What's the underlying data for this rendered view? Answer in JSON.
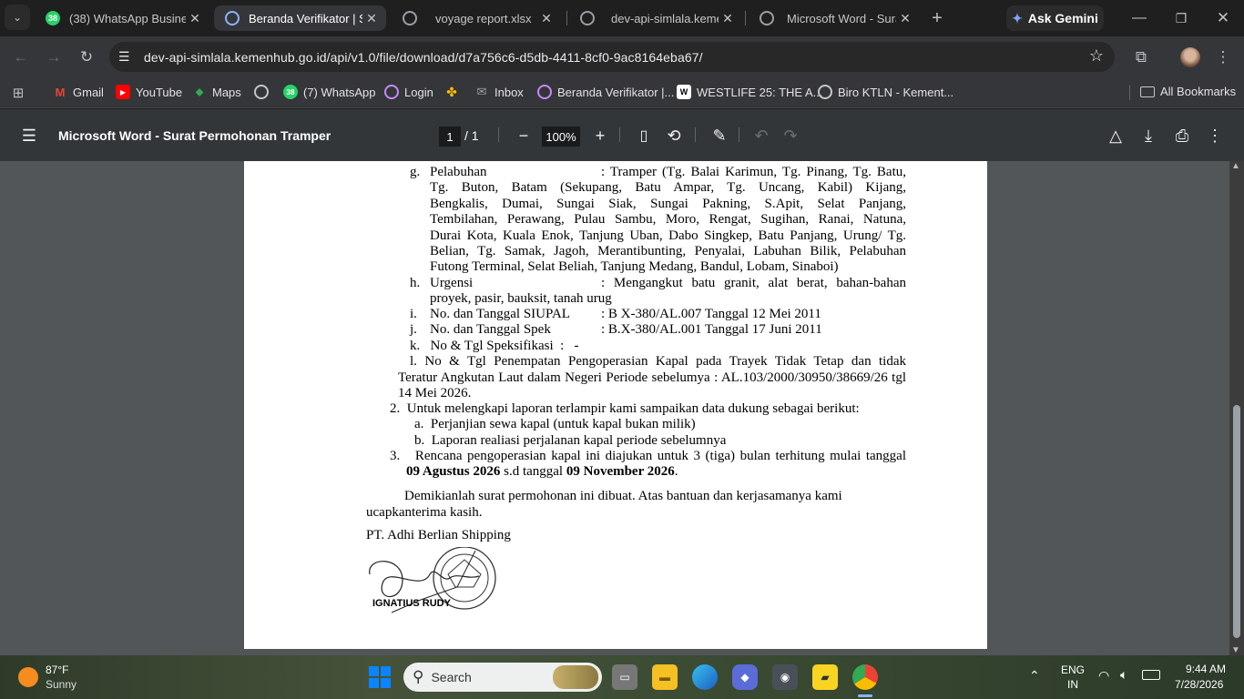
{
  "tabs": [
    {
      "title": "(38) WhatsApp Busines",
      "badge": "38",
      "color": "#25d366"
    },
    {
      "title": "Beranda Verifikator | Si",
      "badge": "",
      "color": "#8ab4f8"
    },
    {
      "title": "voyage report.xlsx",
      "badge": "",
      "color": "#9aa0a6"
    },
    {
      "title": "dev-api-simlala.kemenl",
      "badge": "",
      "color": "#9aa0a6"
    },
    {
      "title": "Microsoft Word - Surat",
      "badge": "",
      "color": "#9aa0a6"
    }
  ],
  "ask_gemini": "Ask Gemini",
  "url": "dev-api-simlala.kemenhub.go.id/api/v1.0/file/download/d7a756c6-d5db-4411-8cf0-9ac8164eba67/",
  "bookmarks": {
    "items": [
      "Gmail",
      "YouTube",
      "Maps",
      "",
      "(7) WhatsApp",
      "Login",
      "",
      "Inbox",
      "Beranda Verifikator |...",
      "WESTLIFE 25: THE A...",
      "Biro KTLN - Kement..."
    ],
    "all": "All Bookmarks"
  },
  "pdf": {
    "title": "Microsoft Word - Surat Permohonan Tramper",
    "page_current": "1",
    "page_total": "/ 1",
    "zoom": "100%"
  },
  "doc": {
    "g_label": "g.",
    "g_key": "Pelabuhan",
    "g_lines": [
      ": Tramper (Tg. Balai Karimun, Tg. Pinang, Tg. Batu,",
      "Tg. Buton, Batam (Sekupang, Batu Ampar, Tg. Uncang, Kabil) Kijang,",
      "Bengkalis, Dumai, Sungai Siak, Sungai Pakning, S.Apit, Selat Panjang,",
      "Tembilahan, Perawang, Pulau Sambu, Moro, Rengat, Sugihan, Ranai, Natuna,",
      "Durai Kota, Kuala Enok, Tanjung Uban, Dabo Singkep, Batu Panjang, Urung/ Tg.",
      "Belian, Tg. Samak, Jagoh, Merantibunting, Penyalai, Labuhan Bilik, Pelabuhan",
      "Futong Terminal, Selat Beliah, Tanjung Medang, Bandul, Lobam, Sinaboi)"
    ],
    "h_label": "h.",
    "h_key": "Urgensi",
    "h_line1": ": Mengangkut batu granit, alat berat, bahan-bahan",
    "h_line2": "proyek, pasir, bauksit, tanah urug",
    "i_label": "i.",
    "i_key": "No. dan Tanggal SIUPAL",
    "i_val": ": B X-380/AL.007 Tanggal 12 Mei 2011",
    "j_label": "j.",
    "j_key": "No. dan Tanggal Spek",
    "j_val": ": B.X-380/AL.001 Tanggal 17 Juni 2011",
    "k_line": "k.   No & Tgl Speksifikasi  :   -",
    "l_line1": "l.   No & Tgl Penempatan Pengoperasian Kapal pada Trayek Tidak Tetap dan tidak",
    "l_line2": "Teratur Angkutan Laut dalam Negeri Periode sebelumya : AL.103/2000/30950/38669/26 tgl",
    "l_line3": "14 Mei 2026.",
    "p2": "2.  Untuk melengkapi laporan terlampir kami sampaikan data dukung sebagai berikut:",
    "p2a": "a.  Perjanjian sewa kapal (untuk kapal bukan milik)",
    "p2b": "b.  Laporan realiasi perjalanan kapal periode sebelumnya",
    "p3_line1": "3.   Rencana pengoperasian kapal ini diajukan untuk 3 (tiga) bulan terhitung mulai tanggal",
    "p3_b1": "09 Agustus 2026",
    "p3_mid": " s.d tanggal ",
    "p3_b2": "09 November 2026",
    "p3_end": ".",
    "closing1": "Demikianlah surat permohonan ini dibuat. Atas bantuan dan kerjasamanya kami",
    "closing2": "ucapkanterima kasih.",
    "company": "PT. Adhi Berlian Shipping",
    "signer": "IGNATIUS RUDY",
    "stamp_text": "ADHI BERLIAN SHIPPING"
  },
  "taskbar": {
    "temp": "87°F",
    "weather": "Sunny",
    "search": "Search",
    "lang1": "ENG",
    "lang2": "IN",
    "time": "9:44 AM",
    "date": "7/28/2026"
  }
}
